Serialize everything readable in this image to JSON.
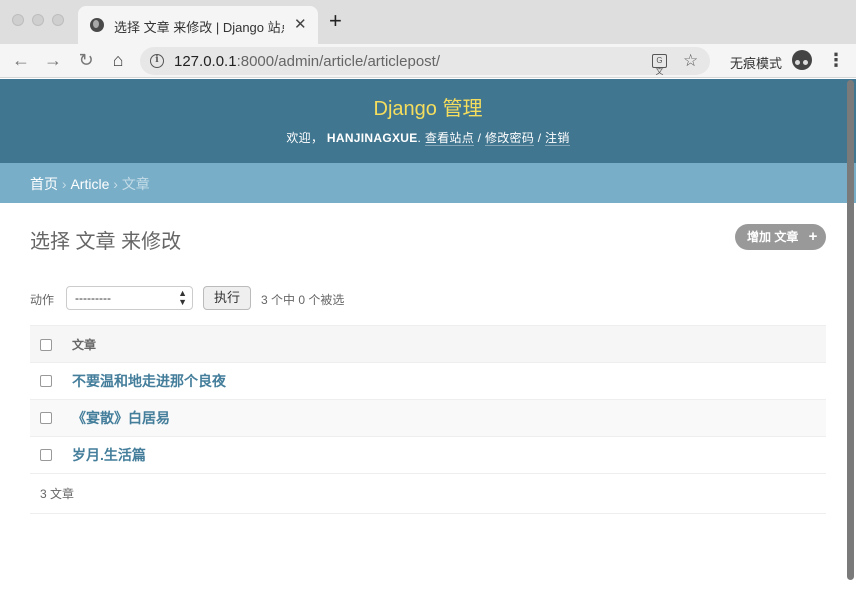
{
  "browser": {
    "tab_title": "选择 文章 来修改 | Django 站点管理",
    "tab_close": "✕",
    "new_tab": "+",
    "url_host": "127.0.0.1",
    "url_rest": ":8000/admin/article/articlepost/",
    "incognito_label": "无痕模式",
    "menu": "⋮"
  },
  "header": {
    "branding": "Django 管理",
    "welcome": "欢迎，",
    "username": "HANJINAGXUE",
    "view_site": "查看站点",
    "change_password": "修改密码",
    "logout": "注销",
    "separator": " / "
  },
  "breadcrumbs": {
    "home": "首页",
    "app": "Article",
    "current": "文章",
    "sep": " › "
  },
  "page": {
    "title": "选择 文章 来修改",
    "add_button": "增加 文章",
    "action_label": "动作",
    "action_selected": "---------",
    "go_button": "执行",
    "action_counter": "3 个中 0 个被选"
  },
  "table": {
    "column_header": "文章",
    "rows": [
      {
        "title": "不要温和地走进那个良夜"
      },
      {
        "title": "《宴散》白居易"
      },
      {
        "title": "岁月.生活篇"
      }
    ]
  },
  "paginator": {
    "count_text": "3 文章"
  },
  "colors": {
    "header_bg": "#417690",
    "branding": "#f5dd5d",
    "breadcrumb_bg": "#79aec8",
    "link": "#447e9b"
  }
}
